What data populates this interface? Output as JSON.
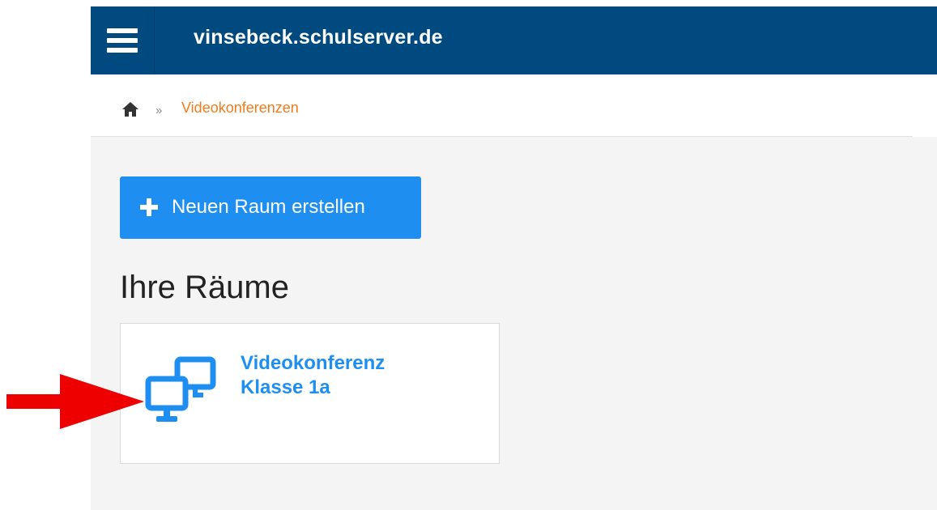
{
  "header": {
    "site_title": "vinsebeck.schulserver.de",
    "menu_icon": "hamburger-menu-icon",
    "background_color": "#004a80"
  },
  "breadcrumb": {
    "home_icon": "home-icon",
    "separator": "»",
    "current": "Videokonferenzen",
    "current_color": "#f07c1b"
  },
  "main": {
    "new_room_button": {
      "icon": "plus-icon",
      "label": "Neuen Raum erstellen",
      "color": "#1e8ff0"
    },
    "section_title": "Ihre Räume",
    "rooms": [
      {
        "icon": "monitors-icon",
        "name_line1": "Videokonferenz",
        "name_line2": "Klasse 1a"
      }
    ]
  },
  "annotation": {
    "arrow_icon": "red-arrow-icon",
    "arrow_color": "#ee0000"
  }
}
